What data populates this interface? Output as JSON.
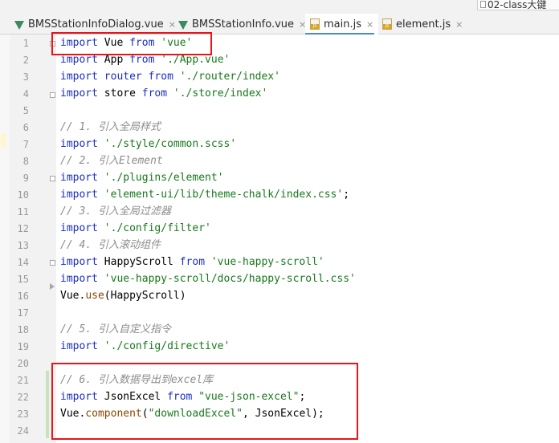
{
  "tabs": [
    {
      "icon": "vue-file-icon",
      "label": "BMSStationInfoDialog.vue",
      "close": "×"
    },
    {
      "icon": "vue-file-icon",
      "label": "BMSStationInfo.vue",
      "close": "×"
    },
    {
      "icon": "js-file-icon",
      "label": "main.js",
      "close": "×",
      "active": true
    },
    {
      "icon": "js-file-icon",
      "label": "element.js",
      "close": "×"
    }
  ],
  "corner_tab": {
    "label": "02-class大键"
  },
  "js_badge": "JS",
  "line_numbers": [
    "1",
    "2",
    "3",
    "4",
    "5",
    "6",
    "7",
    "8",
    "9",
    "10",
    "11",
    "12",
    "13",
    "14",
    "15",
    "16",
    "17",
    "18",
    "19",
    "20",
    "21",
    "22",
    "23",
    "24"
  ],
  "code": {
    "l1": {
      "a": "import",
      "b": " Vue ",
      "c": "from",
      "d": " ",
      "e": "'vue'"
    },
    "l2": {
      "a": "import",
      "b": " App ",
      "c": "from",
      "d": " ",
      "e": "'./App.vue'"
    },
    "l3": {
      "a": "import",
      "b": " router ",
      "c": "from",
      "d": " ",
      "e": "'./router/index'"
    },
    "l4": {
      "a": "import",
      "b": " store ",
      "c": "from",
      "d": " ",
      "e": "'./store/index'"
    },
    "l6": {
      "a": "// 1. 引入全局样式"
    },
    "l7": {
      "a": "import",
      "b": " ",
      "e": "'./style/common.scss'"
    },
    "l8": {
      "a": "// 2. 引入Element"
    },
    "l9": {
      "a": "import",
      "b": " ",
      "e": "'./plugins/element'"
    },
    "l10": {
      "a": "import",
      "b": " ",
      "e": "'element-ui/lib/theme-chalk/index.css'",
      "f": ";"
    },
    "l11": {
      "a": "// 3. 引入全局过滤器"
    },
    "l12": {
      "a": "import",
      "b": " ",
      "e": "'./config/filter'"
    },
    "l13": {
      "a": "// 4. 引入滚动组件"
    },
    "l14": {
      "a": "import",
      "b": " HappyScroll ",
      "c": "from",
      "d": " ",
      "e": "'vue-happy-scroll'"
    },
    "l15": {
      "a": "import",
      "b": " ",
      "e": "'vue-happy-scroll/docs/happy-scroll.css'"
    },
    "l16": {
      "a": "Vue.",
      "b": "use",
      "c": "(HappyScroll)"
    },
    "l18": {
      "a": "// 5. 引入自定义指令"
    },
    "l19": {
      "a": "import",
      "b": " ",
      "e": "'./config/directive'"
    },
    "l21": {
      "a": "// 6. 引入数据导出到excel库"
    },
    "l22": {
      "a": "import",
      "b": " JsonExcel ",
      "c": "from",
      "d": " ",
      "e": "\"vue-json-excel\"",
      "f": ";"
    },
    "l23": {
      "a": "Vue.",
      "b": "component",
      "c": "(",
      "e": "\"downloadExcel\"",
      "f": ", JsonExcel);"
    }
  },
  "colors": {
    "keyword": "#1a2ec2",
    "string": "#18781c",
    "comment": "#8c8c8c",
    "function": "#8a4500",
    "highlight_box": "#e8141b",
    "active_tab_underline": "#4a88d8"
  }
}
